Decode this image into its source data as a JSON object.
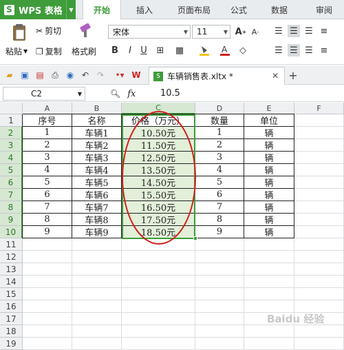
{
  "app": {
    "name": "WPS 表格",
    "logo": "S"
  },
  "ribbon_tabs": [
    "开始",
    "插入",
    "页面布局",
    "公式",
    "数据",
    "审阅"
  ],
  "ribbon": {
    "paste": "粘贴",
    "cut": "剪切",
    "copy": "复制",
    "format_painter": "格式刷",
    "font_name": "宋体",
    "font_size": "11",
    "bold": "B",
    "italic": "I",
    "underline": "U"
  },
  "document": {
    "tab_title": "车辆销售表.xltx *"
  },
  "formula_bar": {
    "cell_ref": "C2",
    "fx": "fx",
    "value": "10.5"
  },
  "columns": [
    "A",
    "B",
    "C",
    "D",
    "E",
    "F"
  ],
  "rows": [
    "1",
    "2",
    "3",
    "4",
    "5",
    "6",
    "7",
    "8",
    "9",
    "10",
    "11",
    "12",
    "13",
    "14",
    "15",
    "16",
    "17",
    "18",
    "19"
  ],
  "table": {
    "headers": [
      "序号",
      "名称",
      "价格（万元）",
      "数量",
      "单位"
    ],
    "rows": [
      [
        "1",
        "车辆1",
        "10.50元",
        "1",
        "辆"
      ],
      [
        "2",
        "车辆2",
        "11.50元",
        "2",
        "辆"
      ],
      [
        "3",
        "车辆3",
        "12.50元",
        "3",
        "辆"
      ],
      [
        "4",
        "车辆4",
        "13.50元",
        "4",
        "辆"
      ],
      [
        "5",
        "车辆5",
        "14.50元",
        "5",
        "辆"
      ],
      [
        "6",
        "车辆6",
        "15.50元",
        "6",
        "辆"
      ],
      [
        "7",
        "车辆7",
        "16.50元",
        "7",
        "辆"
      ],
      [
        "8",
        "车辆8",
        "17.50元",
        "8",
        "辆"
      ],
      [
        "9",
        "车辆9",
        "18.50元",
        "9",
        "辆"
      ]
    ]
  },
  "watermark": "Baidu 经验",
  "colors": {
    "accent": "#3e9c3a",
    "selection_fill": "#e2efd9",
    "annotation": "#d0201c"
  }
}
